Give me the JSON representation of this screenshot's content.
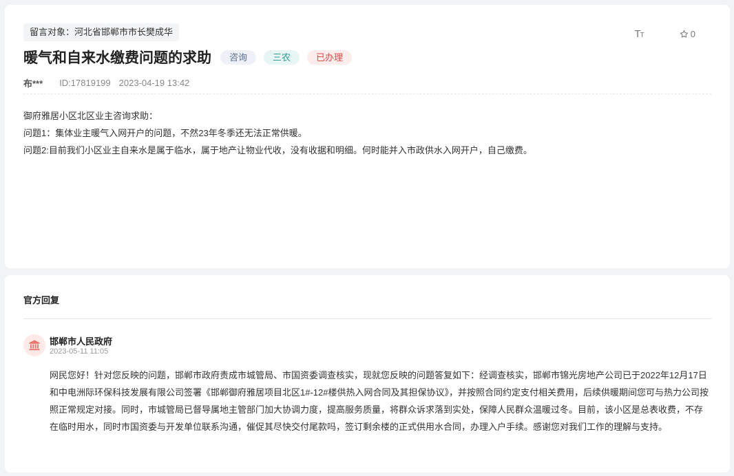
{
  "message": {
    "target_label": "留言对象：河北省邯郸市市长樊成华",
    "title": "暖气和自来水缴费问题的求助",
    "tags": [
      {
        "label": "咨询",
        "color": "#5b6f94"
      },
      {
        "label": "三农",
        "color": "#2f9c92"
      },
      {
        "label": "已办理",
        "color": "#e04848"
      }
    ],
    "author": "布***",
    "id_text": "ID:17819199",
    "datetime": "2023-04-19 13:42",
    "content_lines": [
      "御府雅居小区北区业主咨询求助：",
      "问题1：集体业主暖气入网开户的问题，不然23年冬季还无法正常供暖。",
      "问题2:目前我们小区业主自来水是属于临水，属于地产让物业代收，没有收据和明细。何时能并入市政供水入网开户，自己缴费。"
    ]
  },
  "tools": {
    "font_size_icon": "font-size-icon",
    "favorite_icon": "star-outline-icon",
    "favorite_count": "0"
  },
  "reply": {
    "section_title": "官方回复",
    "org_icon": "government-building-icon",
    "org_name": "邯郸市人民政府",
    "datetime": "2023-05-11 11:05",
    "text": "网民您好！针对您反映的问题，邯郸市政府责成市城管局、市国资委调查核实，现就您反映的问题答复如下：经调查核实，邯郸市锦光房地产公司已于2022年12月17日和中电洲际环保科技发展有限公司签署《邯郸御府雅居项目北区1#-12#楼供热入网合同及其担保协议》，并按照合同约定支付相关费用，后续供暖期间您可与热力公司按照正常规定对接。同时，市城管局已督导属地主管部门加大协调力度，提高服务质量，将群众诉求落到实处，保障人民群众温暖过冬。目前，该小区是总表收费，不存在临时用水，同时市国资委与开发单位联系沟通，催促其尽快交付尾款吗，签订剩余楼的正式供用水合同，办理入户手续。感谢您对我们工作的理解与支持。"
  },
  "colors": {
    "page_bg": "#f2f3f5",
    "tag_blue": "#5b6f94",
    "tag_teal": "#2f9c92",
    "tag_red": "#e04848",
    "gov_icon": "#e8756b"
  }
}
